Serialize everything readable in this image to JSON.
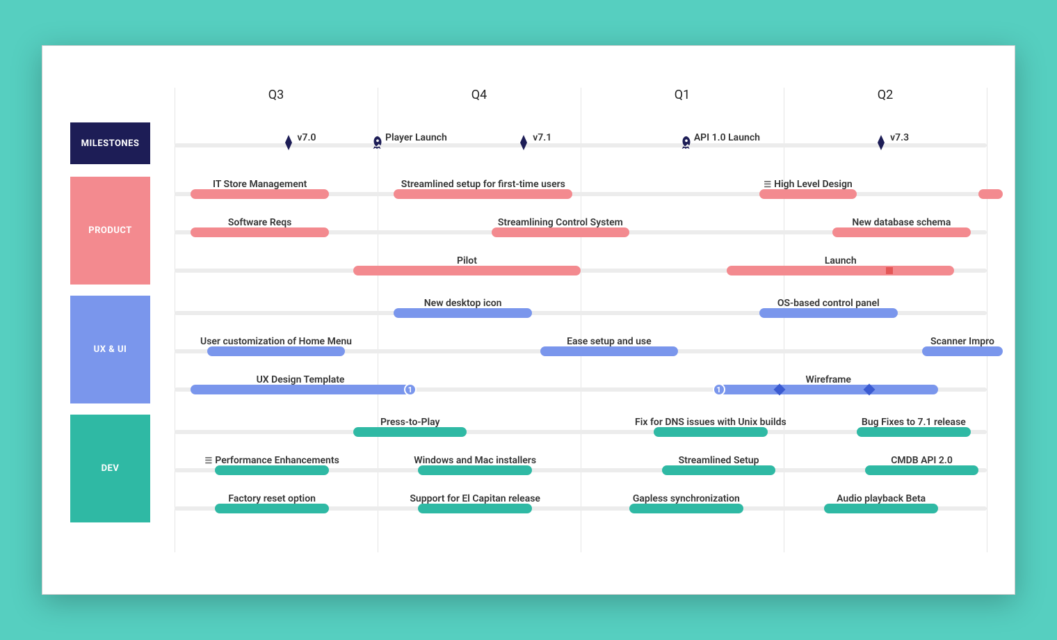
{
  "quarters": [
    "Q3",
    "Q4",
    "Q1",
    "Q2"
  ],
  "lanes": [
    {
      "name": "MILESTONES",
      "color": "#1d1d56"
    },
    {
      "name": "PRODUCT",
      "color": "#f38a8f"
    },
    {
      "name": "UX & UI",
      "color": "#7a96ec"
    },
    {
      "name": "DEV",
      "color": "#2fb9a4"
    }
  ],
  "milestones": [
    {
      "label": "v7.0",
      "x": 0.14,
      "type": "diamond"
    },
    {
      "label": "Player Launch",
      "x": 0.25,
      "type": "rocket"
    },
    {
      "label": "v7.1",
      "x": 0.43,
      "type": "diamond"
    },
    {
      "label": "API 1.0 Launch",
      "x": 0.63,
      "type": "rocket"
    },
    {
      "label": "v7.3",
      "x": 0.87,
      "type": "diamond"
    }
  ],
  "rows": [
    {
      "lane": 1,
      "bars": [
        {
          "label": "IT Store Management",
          "x": 0.02,
          "w": 0.17
        },
        {
          "label": "Streamlined setup for first-time users",
          "x": 0.27,
          "w": 0.22
        },
        {
          "label": "High Level Design",
          "x": 0.72,
          "w": 0.12,
          "icon": true
        },
        {
          "label": "",
          "x": 0.99,
          "w": 0.03
        }
      ]
    },
    {
      "lane": 1,
      "bars": [
        {
          "label": "Software Reqs",
          "x": 0.02,
          "w": 0.17
        },
        {
          "label": "Streamlining Control System",
          "x": 0.39,
          "w": 0.17
        },
        {
          "label": "New database schema",
          "x": 0.81,
          "w": 0.17
        }
      ]
    },
    {
      "lane": 1,
      "bars": [
        {
          "label": "Pilot",
          "x": 0.22,
          "w": 0.28
        },
        {
          "label": "Launch",
          "x": 0.68,
          "w": 0.28,
          "sq": 0.88
        }
      ]
    },
    {
      "lane": 2,
      "bars": [
        {
          "label": "New desktop icon",
          "x": 0.27,
          "w": 0.17
        },
        {
          "label": "OS-based control panel",
          "x": 0.72,
          "w": 0.17
        }
      ]
    },
    {
      "lane": 2,
      "bars": [
        {
          "label": "User customization of Home Menu",
          "x": 0.04,
          "w": 0.17
        },
        {
          "label": "Ease setup and use",
          "x": 0.45,
          "w": 0.17
        },
        {
          "label": "Scanner Impro",
          "x": 0.92,
          "w": 0.1
        }
      ]
    },
    {
      "lane": 2,
      "bars": [
        {
          "label": "UX Design Template",
          "x": 0.02,
          "w": 0.27,
          "badge_right": "1"
        },
        {
          "label": "Wireframe",
          "x": 0.67,
          "w": 0.27,
          "badge_left": "1",
          "dia": [
            0.745,
            0.855
          ]
        }
      ]
    },
    {
      "lane": 3,
      "bars": [
        {
          "label": "Press-to-Play",
          "x": 0.22,
          "w": 0.14
        },
        {
          "label": "Fix for DNS issues with Unix builds",
          "x": 0.59,
          "w": 0.14
        },
        {
          "label": "Bug Fixes to 7.1 release",
          "x": 0.84,
          "w": 0.14
        }
      ]
    },
    {
      "lane": 3,
      "bars": [
        {
          "label": "Performance Enhancements",
          "x": 0.05,
          "w": 0.14,
          "icon": true
        },
        {
          "label": "Windows and Mac installers",
          "x": 0.3,
          "w": 0.14
        },
        {
          "label": "Streamlined Setup",
          "x": 0.6,
          "w": 0.14
        },
        {
          "label": "CMDB API 2.0",
          "x": 0.85,
          "w": 0.14
        }
      ]
    },
    {
      "lane": 3,
      "bars": [
        {
          "label": "Factory reset option",
          "x": 0.05,
          "w": 0.14
        },
        {
          "label": "Support for El Capitan release",
          "x": 0.3,
          "w": 0.14
        },
        {
          "label": "Gapless synchronization",
          "x": 0.56,
          "w": 0.14
        },
        {
          "label": "Audio playback Beta",
          "x": 0.8,
          "w": 0.14
        }
      ]
    }
  ],
  "chart_data": {
    "type": "bar",
    "title": "Product Roadmap Gantt",
    "categories": [
      "Q3",
      "Q4",
      "Q1",
      "Q2"
    ],
    "series": [
      {
        "name": "MILESTONES",
        "items": [
          "v7.0",
          "Player Launch",
          "v7.1",
          "API 1.0 Launch",
          "v7.3"
        ]
      },
      {
        "name": "PRODUCT",
        "items": [
          "IT Store Management",
          "Streamlined setup for first-time users",
          "High Level Design",
          "Software Reqs",
          "Streamlining Control System",
          "New database schema",
          "Pilot",
          "Launch"
        ]
      },
      {
        "name": "UX & UI",
        "items": [
          "New desktop icon",
          "OS-based control panel",
          "User customization of Home Menu",
          "Ease setup and use",
          "Scanner Impro",
          "UX Design Template",
          "Wireframe"
        ]
      },
      {
        "name": "DEV",
        "items": [
          "Press-to-Play",
          "Fix for DNS issues with Unix builds",
          "Bug Fixes to 7.1 release",
          "Performance Enhancements",
          "Windows and Mac installers",
          "Streamlined Setup",
          "CMDB API 2.0",
          "Factory reset option",
          "Support for El Capitan release",
          "Gapless synchronization",
          "Audio playback Beta"
        ]
      }
    ]
  }
}
